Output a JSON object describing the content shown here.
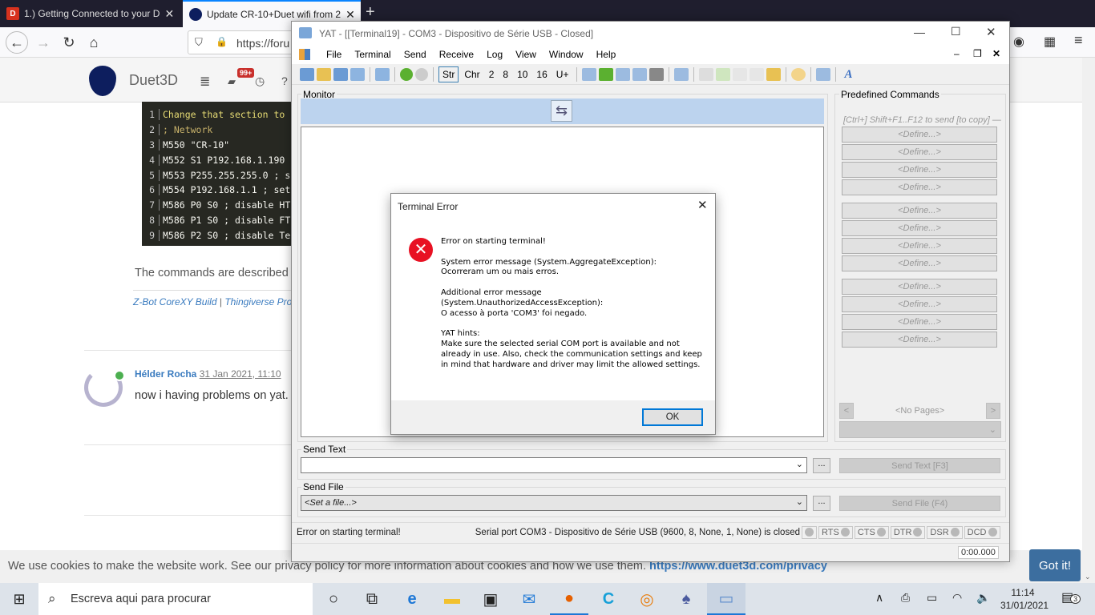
{
  "browser": {
    "tabs": [
      {
        "label": "1.) Getting Connected to your D",
        "favicon": "D",
        "active": false
      },
      {
        "label": "Update CR-10+Duet wifi from 2",
        "active": true
      }
    ],
    "url": "https://foru",
    "new_tab_icon": "plus-icon"
  },
  "site": {
    "brand": "Duet3D",
    "notification_badge": "99+",
    "code_lines": [
      "Change that section to",
      "; Network",
      "M550 \"CR-10\"",
      "M552 S1 P192.168.1.190",
      "M553 P255.255.255.0 ; s",
      "M554 P192.168.1.1 ; set",
      "M586 P0 S0 ; disable HT",
      "M586 P1 S0 ; disable FT",
      "M586 P2 S0 ; disable Te"
    ],
    "description": "The commands are described",
    "signature_links": [
      "Z-Bot CoreXY Build",
      "Thingiverse Profi"
    ],
    "signature_separator": "|",
    "post": {
      "author": "Hélder Rocha",
      "date": "31 Jan 2021, 11:10",
      "text": "now i having problems on yat."
    },
    "cookie": {
      "text": "We use cookies to make the website work. See our privacy policy for more information about cookies and how we use them.",
      "link": "https://www.duet3d.com/privacy",
      "button": "Got it!"
    }
  },
  "yat": {
    "title": "YAT - [[Terminal19] - COM3 - Dispositivo de Série USB - Closed]",
    "menu": [
      "File",
      "Terminal",
      "Send",
      "Receive",
      "Log",
      "View",
      "Window",
      "Help"
    ],
    "radix_buttons": [
      "Str",
      "Chr",
      "2",
      "8",
      "10",
      "16",
      "U+"
    ],
    "monitor_label": "Monitor",
    "predefined": {
      "label": "Predefined Commands",
      "hint": "[Ctrl+] Shift+F1..F12 to send [to copy] —",
      "define_label": "<Define...>",
      "pages": "<No Pages>"
    },
    "send_text": {
      "label": "Send Text",
      "value": "",
      "browse": "...",
      "button": "Send Text [F3]"
    },
    "send_file": {
      "label": "Send File",
      "value": "<Set a file...>",
      "browse": "...",
      "button": "Send File (F4)"
    },
    "status": {
      "message": "Error on starting terminal!",
      "port": "Serial port COM3 - Dispositivo de Série USB (9600, 8, None, 1, None) is closed",
      "signals": [
        "RTS",
        "CTS",
        "DTR",
        "DSR",
        "DCD"
      ],
      "timer": "0:00.000"
    }
  },
  "dialog": {
    "title": "Terminal Error",
    "message": "Error on starting terminal!\n\nSystem error message (System.AggregateException):\nOcorreram um ou mais erros.\n\nAdditional error message\n(System.UnauthorizedAccessException):\nO acesso à porta 'COM3' foi negado.\n\nYAT hints:\nMake sure the selected serial COM port is available and not already in use. Also, check the communication settings and keep in mind that hardware and driver may limit the allowed settings.",
    "ok": "OK",
    "icon": "error-icon"
  },
  "taskbar": {
    "search_placeholder": "Escreva aqui para procurar",
    "time": "11:14",
    "date": "31/01/2021",
    "notifications": "3"
  }
}
